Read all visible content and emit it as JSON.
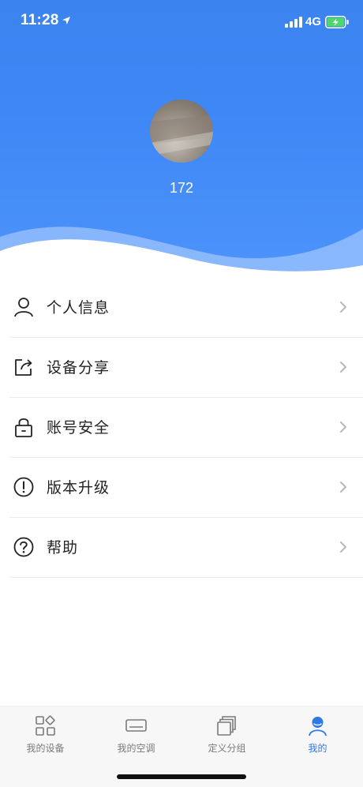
{
  "status_bar": {
    "time": "11:28",
    "network": "4G",
    "icons": [
      "location-arrow-icon",
      "signal-bars-icon",
      "battery-charging-icon"
    ]
  },
  "profile": {
    "username": "172",
    "avatar": "user-avatar-photo"
  },
  "menu": {
    "items": [
      {
        "label": "个人信息",
        "icon": "person-icon"
      },
      {
        "label": "设备分享",
        "icon": "share-icon"
      },
      {
        "label": "账号安全",
        "icon": "lock-icon"
      },
      {
        "label": "版本升级",
        "icon": "exclamation-circle-icon"
      },
      {
        "label": "帮助",
        "icon": "question-circle-icon"
      }
    ]
  },
  "tabbar": {
    "tabs": [
      {
        "label": "我的设备",
        "icon": "devices-grid-icon",
        "active": false
      },
      {
        "label": "我的空调",
        "icon": "air-conditioner-icon",
        "active": false
      },
      {
        "label": "定义分组",
        "icon": "group-stack-icon",
        "active": false
      },
      {
        "label": "我的",
        "icon": "profile-person-icon",
        "active": true
      }
    ]
  },
  "colors": {
    "header_blue": "#3e87f5",
    "accent": "#2f78e8",
    "tab_inactive": "#7a7a7a",
    "battery_green": "#4cd964"
  }
}
